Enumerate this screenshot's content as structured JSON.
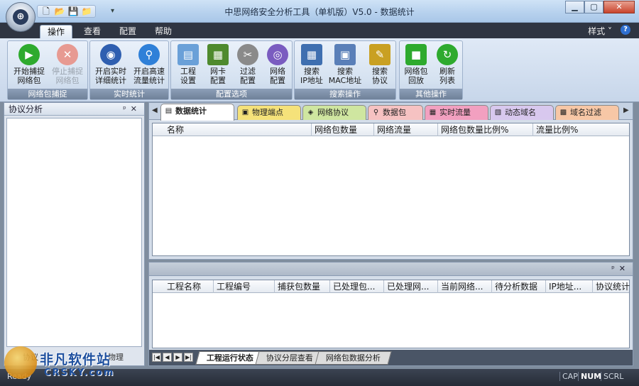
{
  "window": {
    "title": "中思网络安全分析工具（单机版）V5.0 - 数据统计",
    "controls": [
      "minimize",
      "maximize",
      "close"
    ]
  },
  "quick_access": [
    "new-file-icon",
    "open-folder-icon",
    "save-icon",
    "folder-icon"
  ],
  "ribbon_tabs": [
    "操作",
    "查看",
    "配置",
    "帮助"
  ],
  "ribbon_active_tab": "操作",
  "style_menu": "样式",
  "ribbon_groups": [
    {
      "label": "网络包捕捉",
      "buttons": [
        {
          "label": [
            "开始捕捉",
            "网络包"
          ],
          "icon": "play-icon",
          "color": "#2eaa2e",
          "enabled": true
        },
        {
          "label": [
            "停止捕捉",
            "网络包"
          ],
          "icon": "stop-icon",
          "color": "#d9574a",
          "enabled": false
        }
      ]
    },
    {
      "label": "实时统计",
      "buttons": [
        {
          "label": [
            "开启实时",
            "详细统计"
          ],
          "icon": "radar-icon",
          "color": "#2f5fb0",
          "enabled": true
        },
        {
          "label": [
            "开启高速",
            "流量统计"
          ],
          "icon": "search-icon",
          "color": "#2f80d8",
          "enabled": true
        }
      ]
    },
    {
      "label": "配置选项",
      "buttons": [
        {
          "label": [
            "工程",
            "设置"
          ],
          "icon": "project-icon",
          "color": "#6aa0d8",
          "enabled": true
        },
        {
          "label": [
            "网卡",
            "配置"
          ],
          "icon": "network-card-icon",
          "color": "#4f8a2e",
          "enabled": true
        },
        {
          "label": [
            "过滤",
            "配置"
          ],
          "icon": "scissors-icon",
          "color": "#8a8a8a",
          "enabled": true
        },
        {
          "label": [
            "网络",
            "配置"
          ],
          "icon": "globe-icon",
          "color": "#7a5cc0",
          "enabled": true
        }
      ]
    },
    {
      "label": "搜索操作",
      "buttons": [
        {
          "label": [
            "搜索",
            "IP地址"
          ],
          "icon": "grid-search-icon",
          "color": "#3f6fb0",
          "enabled": true
        },
        {
          "label": [
            "搜索",
            "MAC地址"
          ],
          "icon": "mac-search-icon",
          "color": "#5a7fb8",
          "enabled": true
        },
        {
          "label": [
            "搜索",
            "协议"
          ],
          "icon": "protocol-search-icon",
          "color": "#c9a022",
          "enabled": true
        }
      ]
    },
    {
      "label": "其他操作",
      "buttons": [
        {
          "label": [
            "网络包",
            "回放"
          ],
          "icon": "camera-icon",
          "color": "#2eaa2e",
          "enabled": true
        },
        {
          "label": [
            "刷新",
            "列表"
          ],
          "icon": "refresh-icon",
          "color": "#2eaa2e",
          "enabled": true
        }
      ]
    }
  ],
  "left_panel": {
    "title": "协议分析",
    "pin": "ᵖ",
    "close": "✕",
    "tabs": [
      "协议",
      "物理"
    ]
  },
  "doc_tabs": [
    {
      "label": "数据统计",
      "color": "#ffffff",
      "icon": "table-icon",
      "active": true
    },
    {
      "label": "物理端点",
      "color": "#f5e27a",
      "icon": "endpoint-icon",
      "active": false
    },
    {
      "label": "网络协议",
      "color": "#cfe6a0",
      "icon": "protocol-icon",
      "active": false
    },
    {
      "label": "数据包",
      "color": "#f6c2c2",
      "icon": "packet-icon",
      "active": false
    },
    {
      "label": "实时流量",
      "color": "#f2a0c0",
      "icon": "traffic-icon",
      "active": false
    },
    {
      "label": "动态域名",
      "color": "#d8c8ee",
      "icon": "domain-icon",
      "active": false
    },
    {
      "label": "域名过滤",
      "color": "#f7c7a6",
      "icon": "filter-icon",
      "active": false
    }
  ],
  "main_columns": [
    "名称",
    "网络包数量",
    "网络流量",
    "网络包数量比例%",
    "流量比例%"
  ],
  "bottom_columns": [
    "工程名称",
    "工程编号",
    "捕获包数量",
    "已处理包...",
    "已处理网...",
    "当前网络...",
    "待分析数据",
    "IP地址...",
    "协议统计"
  ],
  "bottom_tabs": [
    "工程运行状态",
    "协议分层查看",
    "网络包数据分析"
  ],
  "bottom_active_tab": "工程运行状态",
  "status": {
    "ready": "Ready",
    "indicators": [
      {
        "label": "CAP",
        "on": false
      },
      {
        "label": "NUM",
        "on": true
      },
      {
        "label": "SCRL",
        "on": false
      }
    ]
  },
  "watermark": {
    "line1": "非凡软件站",
    "line2": "CRSKY.com"
  }
}
